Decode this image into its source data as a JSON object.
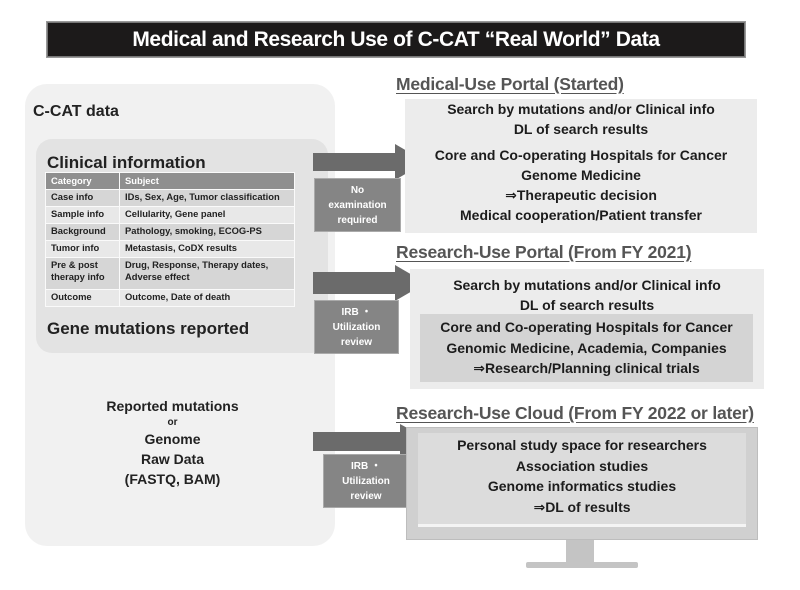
{
  "title": "Medical and Research Use of C-CAT “Real World” Data",
  "left": {
    "ccat_label": "C-CAT data",
    "clinical": {
      "title": "Clinical information",
      "headers": [
        "Category",
        "Subject"
      ],
      "rows": [
        {
          "category": "Case info",
          "subject": "IDs, Sex, Age, Tumor classification"
        },
        {
          "category": "Sample info",
          "subject": "Cellularity, Gene panel"
        },
        {
          "category": "Background",
          "subject": "Pathology, smoking, ECOG-PS"
        },
        {
          "category": "Tumor info",
          "subject": "Metastasis, CoDX results"
        },
        {
          "category": "Pre & post therapy info",
          "subject": "Drug, Response, Therapy dates, Adverse effect"
        },
        {
          "category": "Outcome",
          "subject": "Outcome, Date of death"
        }
      ]
    },
    "gene_label": "Gene mutations reported",
    "raw": {
      "line1": "Reported mutations",
      "or": "or",
      "line2": "Genome",
      "line3": "Raw Data",
      "line4": "(FASTQ, BAM)"
    }
  },
  "reviews": [
    {
      "line1": "No",
      "line2": "examination",
      "line3": "required"
    },
    {
      "line1": "IRB ・",
      "line2": "Utilization",
      "line3": "review"
    },
    {
      "line1": "IRB ・",
      "line2": "Utilization",
      "line3": "review"
    }
  ],
  "portals": {
    "medical": {
      "title": "Medical-Use Portal (Started)",
      "lines": [
        "Search by mutations and/or Clinical info",
        "DL of search results",
        "Core and Co-operating Hospitals for Cancer",
        "Genome Medicine",
        "⇒Therapeutic decision",
        "Medical cooperation/Patient transfer"
      ]
    },
    "research": {
      "title": "Research-Use Portal (From FY 2021)",
      "lines": [
        "Search by mutations and/or Clinical info",
        "DL of search results"
      ],
      "inner_lines": [
        "Core and Co-operating Hospitals for Cancer",
        "Genomic Medicine, Academia, Companies",
        "⇒Research/Planning clinical trials"
      ]
    },
    "cloud": {
      "title": "Research-Use Cloud (From FY 2022 or later)",
      "lines": [
        "Personal study space for researchers",
        "Association studies",
        "Genome informatics studies",
        "⇒DL of results"
      ]
    }
  },
  "colors": {
    "title_bg": "#1c1a1a",
    "arrow": "#6b6b6b",
    "review_bg": "#858585",
    "panel_light": "#f1f1f1",
    "panel_mid": "#e3e3e3",
    "section_title": "#555555"
  }
}
